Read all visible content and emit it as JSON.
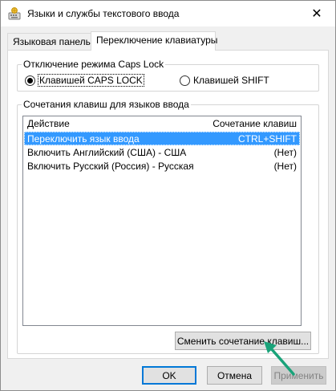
{
  "window": {
    "title": "Языки и службы текстового ввода",
    "close_glyph": "✕"
  },
  "tabs": [
    {
      "label": "Языковая панель",
      "active": false
    },
    {
      "label": "Переключение клавиатуры",
      "active": true
    }
  ],
  "caps_lock": {
    "legend": "Отключение режима Caps Lock",
    "options": [
      {
        "label": "Клавишей CAPS LOCK",
        "checked": true
      },
      {
        "label": "Клавишей SHIFT",
        "checked": false
      }
    ]
  },
  "hotkeys": {
    "legend": "Сочетания клавиш для языков ввода",
    "columns": {
      "action": "Действие",
      "keys": "Сочетание клавиш"
    },
    "rows": [
      {
        "action": "Переключить язык ввода",
        "keys": "CTRL+SHIFT",
        "selected": true
      },
      {
        "action": "Включить Английский (США) - США",
        "keys": "(Нет)",
        "selected": false
      },
      {
        "action": "Включить Русский (Россия) - Русская",
        "keys": "(Нет)",
        "selected": false
      }
    ],
    "change_button": "Сменить сочетание клавиш..."
  },
  "footer": {
    "ok": "OK",
    "cancel": "Отмена",
    "apply": "Применить"
  },
  "colors": {
    "selection": "#3399ff",
    "default_button_border": "#0078d7",
    "annotation_arrow": "#1aa37a"
  },
  "icons": {
    "window_icon": "keyboard-language-icon",
    "close": "close-icon",
    "annotation": "green-arrow-icon"
  }
}
